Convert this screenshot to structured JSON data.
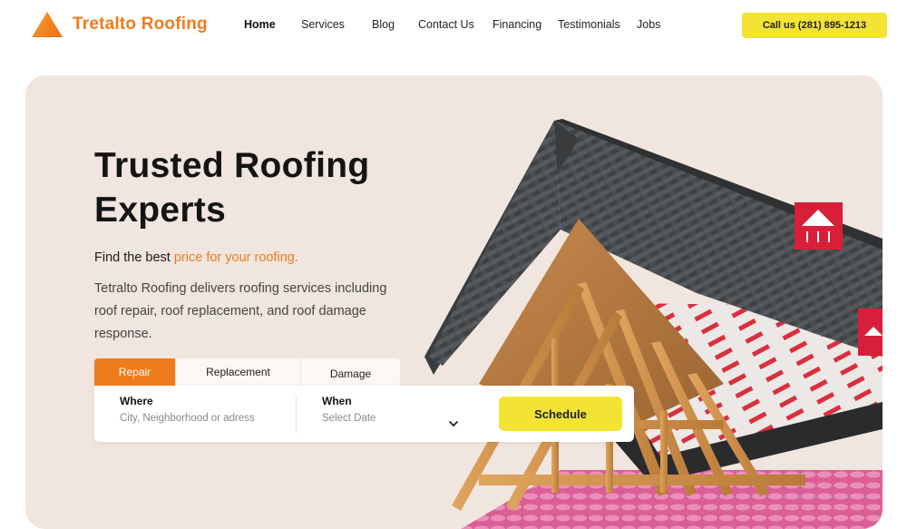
{
  "brand": {
    "name": "Tretalto Roofing",
    "color": "#f07b1d"
  },
  "nav": {
    "items": [
      {
        "label": "Home",
        "active": true
      },
      {
        "label": "Services",
        "active": false
      },
      {
        "label": "Blog",
        "active": false
      },
      {
        "label": "Contact Us",
        "active": false
      },
      {
        "label": "Financing",
        "active": false
      },
      {
        "label": "Testimonials",
        "active": false
      },
      {
        "label": "Jobs",
        "active": false
      }
    ],
    "call_label": "Call us (281) 895-1213"
  },
  "hero": {
    "title": "Trusted Roofing Experts",
    "tagline_prefix": "Find the best ",
    "tagline_highlight": "price for your roofing.",
    "description": "Tetralto Roofing delivers roofing services including roof repair, roof replacement, and roof damage response.",
    "image": "roof-layers-cutaway-illustration"
  },
  "booking": {
    "tabs": [
      {
        "label": "Repair",
        "active": true
      },
      {
        "label": "Replacement",
        "active": false
      },
      {
        "label": "Damage",
        "active": false
      }
    ],
    "where": {
      "label": "Where",
      "placeholder": "City, Neighborhood or adress"
    },
    "when": {
      "label": "When",
      "placeholder": "Select Date",
      "icon": "chevron-down-icon"
    },
    "schedule_label": "Schedule"
  },
  "colors": {
    "accent": "#f07b1d",
    "cta": "#f2e334",
    "hero_bg": "#f0e6df"
  }
}
